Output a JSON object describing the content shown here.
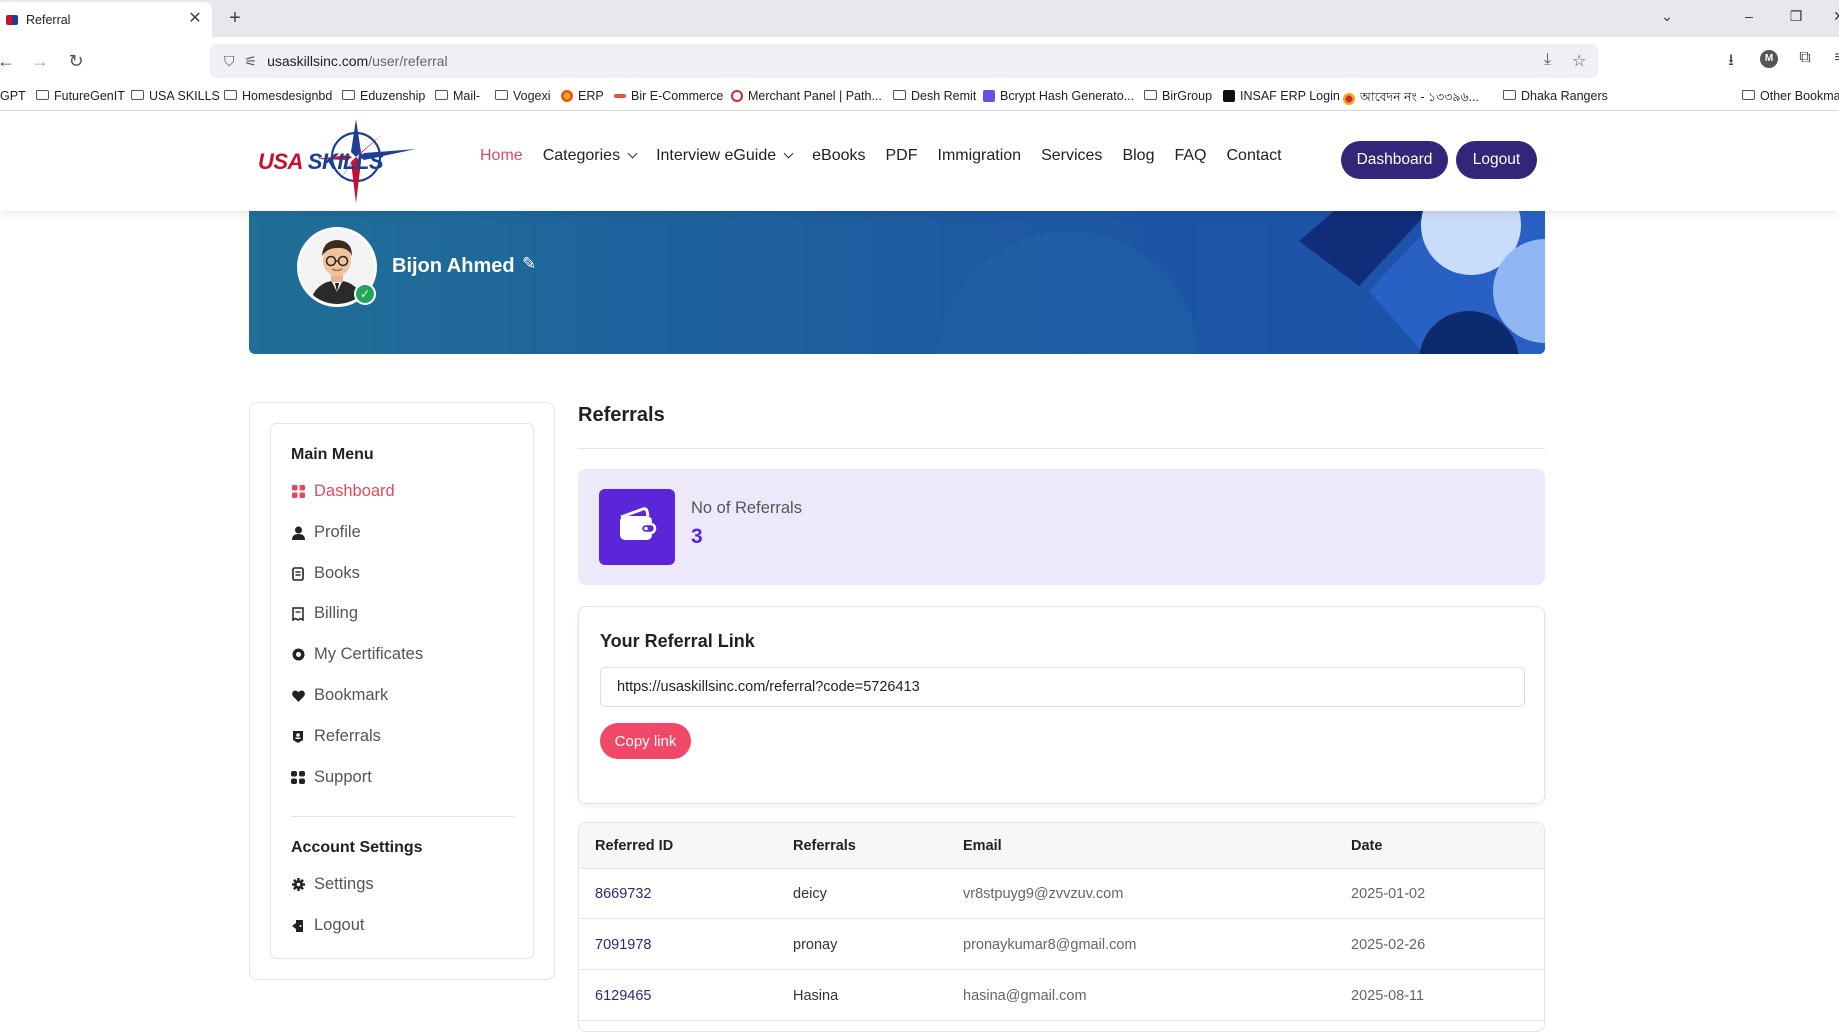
{
  "browser": {
    "tab_title": "Referral",
    "url_host": "usaskillsinc.com",
    "url_path": "/user/referral",
    "bookmarks": [
      "GPT",
      "FutureGenIT",
      "USA SKILLS",
      "Homesdesignbd",
      "Eduzenship",
      "Mail-",
      "Vogexi",
      "ERP",
      "Bir E-Commerce",
      "Merchant Panel | Path...",
      "Desh Remit",
      "Bcrypt Hash Generato...",
      "BirGroup",
      "INSAF ERP Login",
      "আবেদন নং - ১৩৩৯৬...",
      "Dhaka Rangers",
      "Other Bookma"
    ],
    "profile_initial": "M"
  },
  "header": {
    "logo_usa": "USA",
    "logo_skills": "SKILLS",
    "nav": [
      "Home",
      "Categories",
      "Interview eGuide",
      "eBooks",
      "PDF",
      "Immigration",
      "Services",
      "Blog",
      "FAQ",
      "Contact"
    ],
    "dashboard_label": "Dashboard",
    "logout_label": "Logout"
  },
  "profile": {
    "name": "Bijon Ahmed"
  },
  "sidebar": {
    "main_menu_title": "Main Menu",
    "items": [
      "Dashboard",
      "Profile",
      "Books",
      "Billing",
      "My Certificates",
      "Bookmark",
      "Referrals",
      "Support"
    ],
    "account_title": "Account Settings",
    "account_items": [
      "Settings",
      "Logout"
    ]
  },
  "main": {
    "title": "Referrals",
    "stat_label": "No of Referrals",
    "stat_value": "3",
    "link_title": "Your Referral Link",
    "link_value": "https://usaskillsinc.com/referral?code=5726413",
    "copy_label": "Copy link",
    "table": {
      "headers": [
        "Referred ID",
        "Referrals",
        "Email",
        "Date"
      ],
      "rows": [
        [
          "8669732",
          "deicy",
          "vr8stpuyg9@zvvzuv.com",
          "2025-01-02"
        ],
        [
          "7091978",
          "pronay",
          "pronaykumar8@gmail.com",
          "2025-02-26"
        ],
        [
          "6129465",
          "Hasina",
          "hasina@gmail.com",
          "2025-08-11"
        ]
      ]
    }
  },
  "colors": {
    "accent_pink": "#e24a5f",
    "brand_navy": "#32257a",
    "stat_purple": "#5b26d9"
  }
}
